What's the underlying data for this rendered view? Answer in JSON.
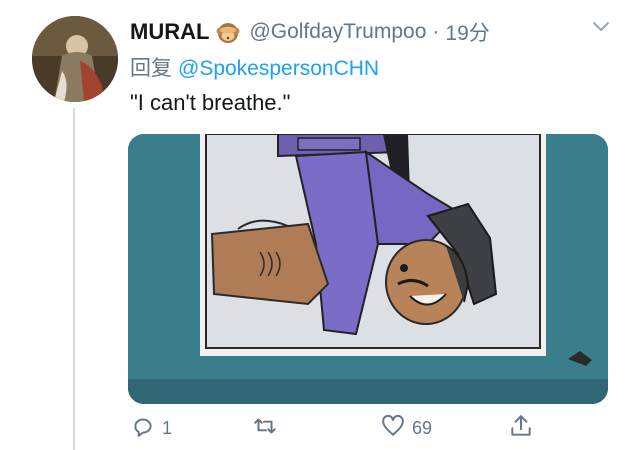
{
  "tweet": {
    "display_name": "MURAL",
    "name_emoji_icon": "see-no-evil-monkey-icon",
    "handle": "@GolfdayTrumpoo",
    "separator": "·",
    "timestamp": "19分",
    "reply_prefix": "回复",
    "reply_to": "@SpokespersonCHN",
    "text": "\"I can't breathe.\"",
    "media": {
      "description_icon": "cartoon-illustration",
      "frame_color": "#3a7e8b"
    },
    "actions": {
      "reply": {
        "icon": "reply-icon",
        "count": "1"
      },
      "retweet": {
        "icon": "retweet-icon",
        "count": ""
      },
      "like": {
        "icon": "heart-icon",
        "count": "69"
      },
      "share": {
        "icon": "share-icon",
        "count": ""
      }
    },
    "more_icon": "chevron-down-icon"
  },
  "colors": {
    "link_blue": "#1da1f2",
    "muted_gray": "#657786",
    "text_dark": "#14171a"
  }
}
